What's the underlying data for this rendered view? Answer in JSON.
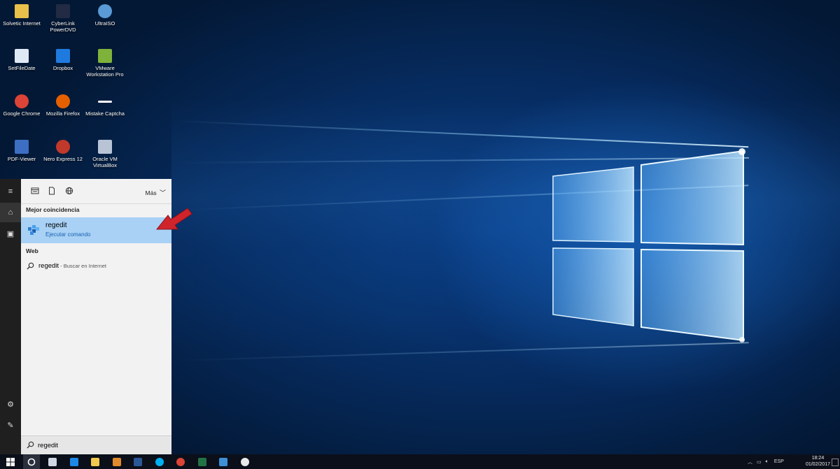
{
  "desktop": {
    "icons": [
      {
        "label": "Solvetic Internet",
        "icon": "folder-icon",
        "color": "#e8c04a"
      },
      {
        "label": "CyberLink\nPowerDVD",
        "icon": "powerdvd-icon",
        "color": "#222a44"
      },
      {
        "label": "UltraISO",
        "icon": "ultraiso-icon",
        "color": "#5a9ad6"
      },
      {
        "label": "SetFileDate",
        "icon": "setfiledate-icon",
        "color": "#dfe9f5"
      },
      {
        "label": "Dropbox",
        "icon": "dropbox-icon",
        "color": "#1f7ae0"
      },
      {
        "label": "VMware\nWorkstation Pro",
        "icon": "vmware-icon",
        "color": "#7fb23a"
      },
      {
        "label": "Google Chrome",
        "icon": "chrome-icon",
        "color": "#db4437"
      },
      {
        "label": "Mozilla Firefox",
        "icon": "firefox-icon",
        "color": "#e66000"
      },
      {
        "label": "Mistake Captcha",
        "icon": "captcha-icon",
        "color": "#ffffff"
      },
      {
        "label": "PDF-Viewer",
        "icon": "pdf-viewer-icon",
        "color": "#3c6fc4"
      },
      {
        "label": "Nero Express 12",
        "icon": "nero-icon",
        "color": "#c0392b"
      },
      {
        "label": "Oracle VM\nVirtualBox",
        "icon": "virtualbox-icon",
        "color": "#b8c4d6"
      }
    ]
  },
  "rail": {
    "items": [
      {
        "name": "hamburger-menu-icon",
        "glyph": "≡"
      },
      {
        "name": "home-icon",
        "glyph": "⌂"
      },
      {
        "name": "notebook-icon",
        "glyph": "▣"
      },
      {
        "name": "settings-gear-icon",
        "glyph": "⚙"
      },
      {
        "name": "feedback-icon",
        "glyph": "✎"
      }
    ]
  },
  "search_panel": {
    "more_label": "Más",
    "best_match_header": "Mejor coincidencia",
    "best_match": {
      "title": "regedit",
      "subtitle": "Ejecutar comando"
    },
    "web_header": "Web",
    "web_result": {
      "term": "regedit",
      "suffix": " - Buscar en Internet"
    },
    "search_value": "regedit"
  },
  "taskbar": {
    "apps": [
      {
        "name": "task-view-icon",
        "color": "#cfd6e4"
      },
      {
        "name": "edge-icon",
        "color": "#1e88e5"
      },
      {
        "name": "file-explorer-icon",
        "color": "#f2c94c"
      },
      {
        "name": "media-player-icon",
        "color": "#e08a2c"
      },
      {
        "name": "word-icon",
        "color": "#2b5797"
      },
      {
        "name": "skype-icon",
        "color": "#00aff0"
      },
      {
        "name": "chrome-icon",
        "color": "#db4437"
      },
      {
        "name": "excel-icon",
        "color": "#217346"
      },
      {
        "name": "regedit-icon",
        "color": "#3d8fd6"
      },
      {
        "name": "captcha-app-icon",
        "color": "#e9e9e9"
      }
    ],
    "language": "ESP",
    "time": "18:24",
    "date": "01/02/2017"
  },
  "colors": {
    "accent": "#1a62b0",
    "highlight": "#a8d1f5",
    "arrow": "#d0242b"
  }
}
